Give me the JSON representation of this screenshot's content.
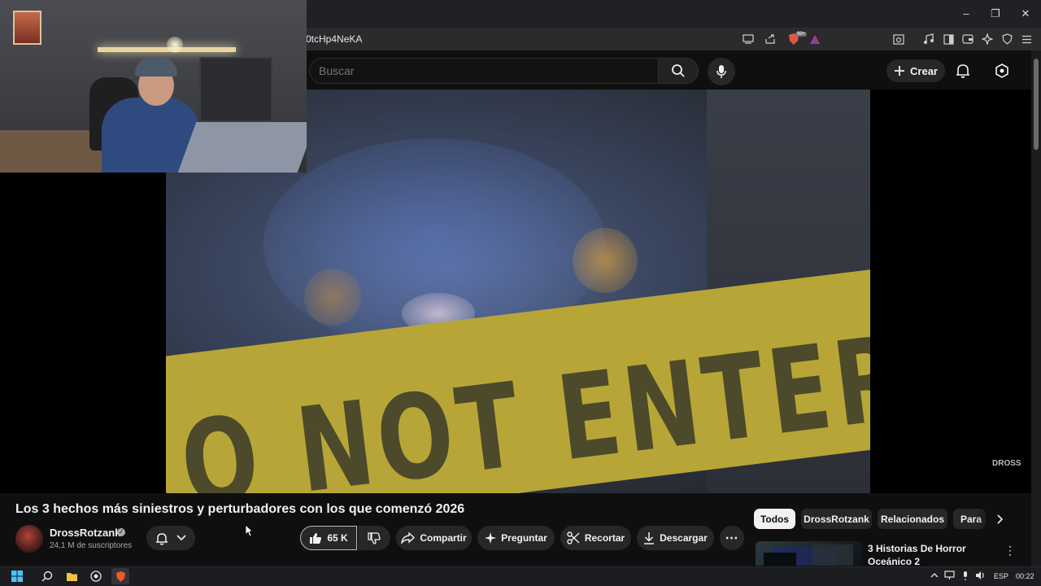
{
  "browser": {
    "url_fragment": "0tcHp4NeKA",
    "window_controls": [
      "minimize",
      "restore",
      "close"
    ],
    "toolbar_icons": [
      "cast-icon",
      "share-icon",
      "brave-shield-icon",
      "brave-rewards-icon",
      "screenshot-icon",
      "music-icon",
      "sidebar-icon",
      "wallet-icon",
      "leo-icon",
      "vpn-icon",
      "menu-icon"
    ],
    "shield_badge": "99+"
  },
  "header": {
    "search_placeholder": "Buscar",
    "create_label": "Crear"
  },
  "video": {
    "tape_text": "O NOT ENTER CRIM",
    "watermark": "DROSS"
  },
  "info": {
    "title": "Los 3 hechos más siniestros y perturbadores con los que comenzó 2026",
    "channel_name": "DrossRotzank",
    "subscribers": "24,1 M de suscriptores",
    "likes": "65 K",
    "share_label": "Compartir",
    "ask_label": "Preguntar",
    "clip_label": "Recortar",
    "download_label": "Descargar",
    "more_label": "⋯"
  },
  "chips": {
    "all": "Todos",
    "channel": "DrossRotzank",
    "related": "Relacionados",
    "partial": "Para"
  },
  "related": {
    "title": "3 Historias De Horror Oceánico 2"
  },
  "taskbar": {
    "language": "ESP",
    "time": "00:22"
  }
}
